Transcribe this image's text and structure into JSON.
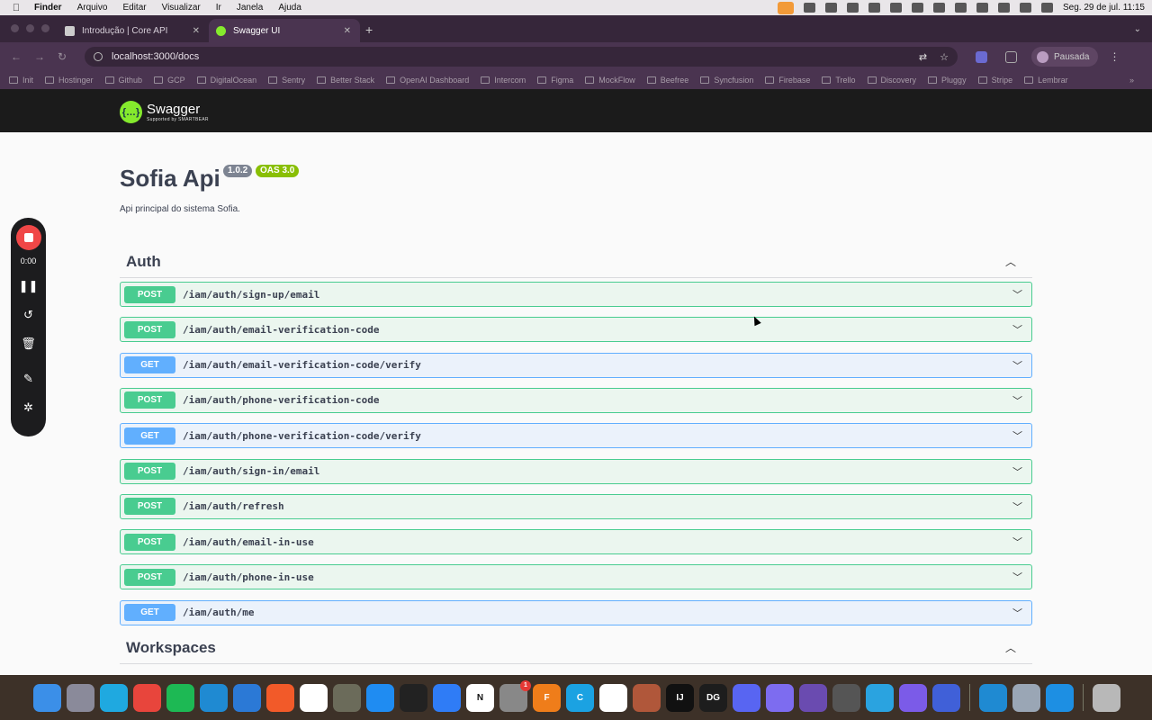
{
  "menubar": {
    "app": "Finder",
    "items": [
      "Arquivo",
      "Editar",
      "Visualizar",
      "Ir",
      "Janela",
      "Ajuda"
    ],
    "clock": "Seg. 29 de jul.  11:15"
  },
  "tabs": [
    {
      "label": "Introdução | Core API",
      "active": false
    },
    {
      "label": "Swagger UI",
      "active": true
    }
  ],
  "address": {
    "url": "localhost:3000/docs"
  },
  "profile": {
    "label": "Pausada"
  },
  "bookmarks": [
    "Init",
    "Hostinger",
    "Github",
    "GCP",
    "DigitalOcean",
    "Sentry",
    "Better Stack",
    "OpenAI Dashboard",
    "Intercom",
    "Figma",
    "MockFlow",
    "Beefree",
    "Syncfusion",
    "Firebase",
    "Trello",
    "Discovery",
    "Pluggy",
    "Stripe",
    "Lembrar"
  ],
  "swagger": {
    "logo_name": "Swagger",
    "logo_sub": "Supported by SMARTBEAR"
  },
  "api": {
    "title": "Sofia Api",
    "version": "1.0.2",
    "oas": "OAS 3.0",
    "description": "Api principal do sistema Sofia."
  },
  "sections": [
    {
      "name": "Auth",
      "operations": [
        {
          "method": "POST",
          "path": "/iam/auth/sign-up/email"
        },
        {
          "method": "POST",
          "path": "/iam/auth/email-verification-code"
        },
        {
          "method": "GET",
          "path": "/iam/auth/email-verification-code/verify"
        },
        {
          "method": "POST",
          "path": "/iam/auth/phone-verification-code"
        },
        {
          "method": "GET",
          "path": "/iam/auth/phone-verification-code/verify"
        },
        {
          "method": "POST",
          "path": "/iam/auth/sign-in/email"
        },
        {
          "method": "POST",
          "path": "/iam/auth/refresh"
        },
        {
          "method": "POST",
          "path": "/iam/auth/email-in-use"
        },
        {
          "method": "POST",
          "path": "/iam/auth/phone-in-use"
        },
        {
          "method": "GET",
          "path": "/iam/auth/me"
        }
      ]
    },
    {
      "name": "Workspaces",
      "operations": []
    }
  ],
  "recorder": {
    "time": "0:00"
  },
  "dock": {
    "badge": "1",
    "apps": [
      {
        "name": "Finder",
        "color": "#3b8fe8",
        "glyph": ""
      },
      {
        "name": "Launchpad",
        "color": "#8a8a9a",
        "glyph": ""
      },
      {
        "name": "Files",
        "color": "#1fa9e0",
        "glyph": ""
      },
      {
        "name": "Chrome",
        "color": "#e8453c",
        "glyph": ""
      },
      {
        "name": "Spotify",
        "color": "#1db954",
        "glyph": ""
      },
      {
        "name": "VS Code",
        "color": "#1f8ad2",
        "glyph": ""
      },
      {
        "name": "App",
        "color": "#2b79d6",
        "glyph": ""
      },
      {
        "name": "Pencil",
        "color": "#f25a29",
        "glyph": ""
      },
      {
        "name": "Slack",
        "color": "#ffffff",
        "glyph": ""
      },
      {
        "name": "GIMP",
        "color": "#6b6b5a",
        "glyph": ""
      },
      {
        "name": "App Store",
        "color": "#1f8cf2",
        "glyph": ""
      },
      {
        "name": "Monitor",
        "color": "#222222",
        "glyph": ""
      },
      {
        "name": "Xcode",
        "color": "#2f7cf6",
        "glyph": ""
      },
      {
        "name": "Notion",
        "color": "#ffffff",
        "glyph": "N"
      },
      {
        "name": "Settings",
        "color": "#888888",
        "glyph": ""
      },
      {
        "name": "Figma 360",
        "color": "#ef7d1a",
        "glyph": "F"
      },
      {
        "name": "C App",
        "color": "#1ba2e2",
        "glyph": "C"
      },
      {
        "name": "MongoDB",
        "color": "#ffffff",
        "glyph": ""
      },
      {
        "name": "MATLAB",
        "color": "#b0573a",
        "glyph": ""
      },
      {
        "name": "IntelliJ",
        "color": "#111111",
        "glyph": "IJ"
      },
      {
        "name": "DataGrip",
        "color": "#1d1d1d",
        "glyph": "DG"
      },
      {
        "name": "Discord",
        "color": "#5865f2",
        "glyph": ""
      },
      {
        "name": "Logic",
        "color": "#7d6cf0",
        "glyph": ""
      },
      {
        "name": "Ball",
        "color": "#6a4bb0",
        "glyph": ""
      },
      {
        "name": "Unity",
        "color": "#555555",
        "glyph": ""
      },
      {
        "name": "Telegram",
        "color": "#2aa3e0",
        "glyph": ""
      },
      {
        "name": "Rewind",
        "color": "#7b5be8",
        "glyph": ""
      },
      {
        "name": "React",
        "color": "#4060d8",
        "glyph": ""
      },
      {
        "name": "VS Code 2",
        "color": "#1f8ad2",
        "glyph": ""
      },
      {
        "name": "Disk",
        "color": "#9aa6b5",
        "glyph": ""
      },
      {
        "name": "Docker",
        "color": "#1d8fe3",
        "glyph": ""
      },
      {
        "name": "Trash",
        "color": "#b8b8b8",
        "glyph": ""
      }
    ]
  }
}
